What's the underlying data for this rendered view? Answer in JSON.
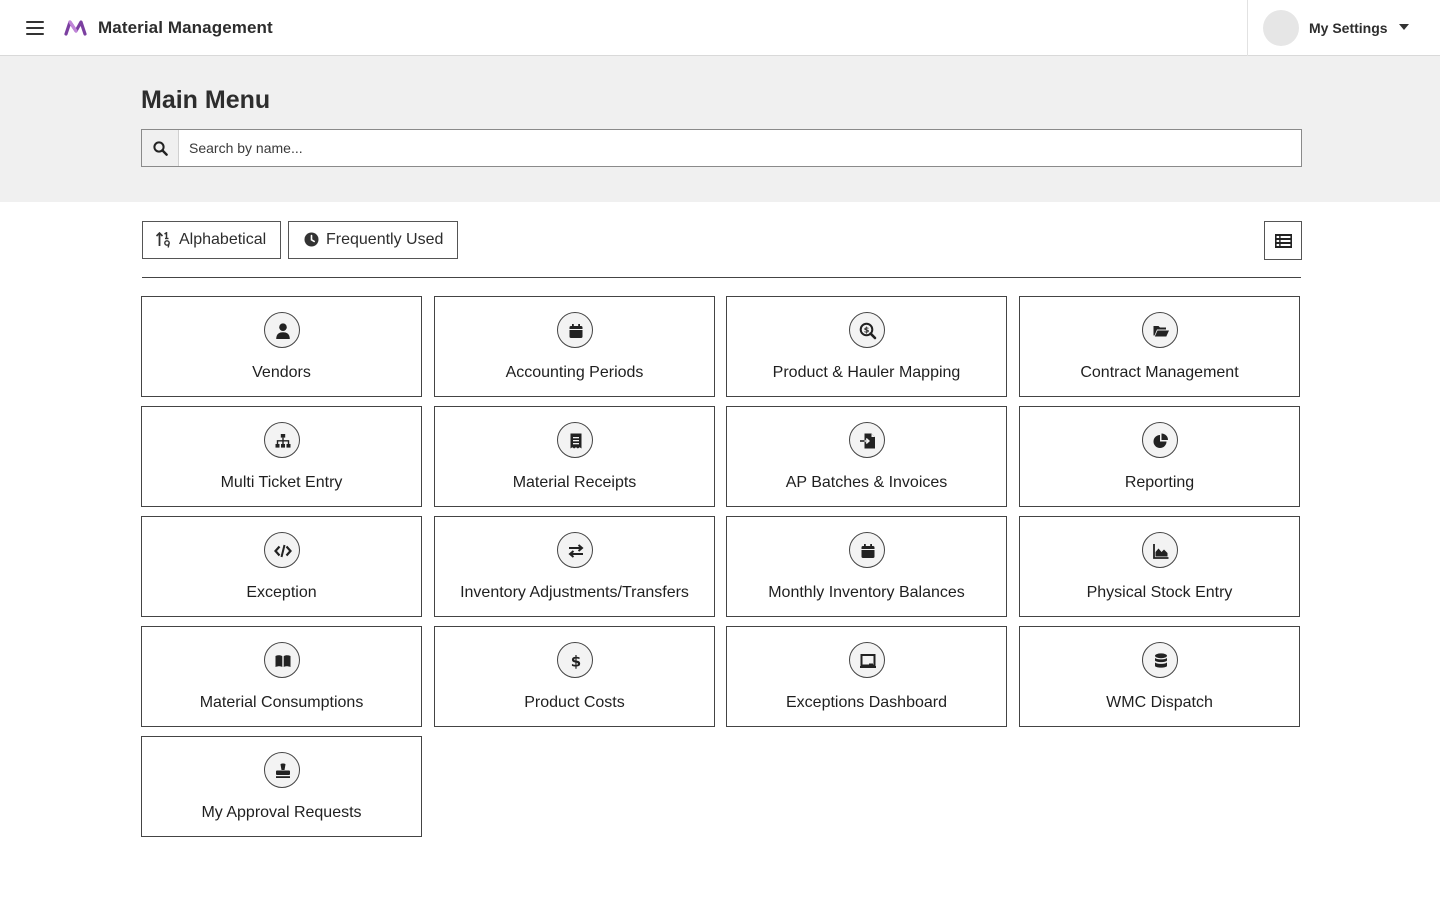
{
  "header": {
    "app_title": "Material Management",
    "settings_label": "My Settings",
    "brand_color": "#7b3fa0"
  },
  "page": {
    "title": "Main Menu",
    "search_placeholder": "Search by name..."
  },
  "sort": {
    "alphabetical_label": "Alphabetical",
    "frequent_label": "Frequently Used"
  },
  "tiles": [
    {
      "label": "Vendors",
      "icon": "user-icon"
    },
    {
      "label": "Accounting Periods",
      "icon": "calendar-icon"
    },
    {
      "label": "Product & Hauler Mapping",
      "icon": "search-dollar-icon"
    },
    {
      "label": "Contract Management",
      "icon": "folder-open-icon"
    },
    {
      "label": "Multi Ticket Entry",
      "icon": "sitemap-icon"
    },
    {
      "label": "Material Receipts",
      "icon": "receipt-icon"
    },
    {
      "label": "AP Batches & Invoices",
      "icon": "file-import-icon"
    },
    {
      "label": "Reporting",
      "icon": "chart-pie-icon"
    },
    {
      "label": "Exception",
      "icon": "code-icon"
    },
    {
      "label": "Inventory Adjustments/Transfers",
      "icon": "exchange-icon"
    },
    {
      "label": "Monthly Inventory Balances",
      "icon": "calendar-icon"
    },
    {
      "label": "Physical Stock Entry",
      "icon": "chart-area-icon"
    },
    {
      "label": "Material Consumptions",
      "icon": "book-open-icon"
    },
    {
      "label": "Product Costs",
      "icon": "dollar-icon"
    },
    {
      "label": "Exceptions Dashboard",
      "icon": "chalkboard-icon"
    },
    {
      "label": "WMC Dispatch",
      "icon": "database-icon"
    },
    {
      "label": "My Approval Requests",
      "icon": "stamp-icon"
    }
  ]
}
